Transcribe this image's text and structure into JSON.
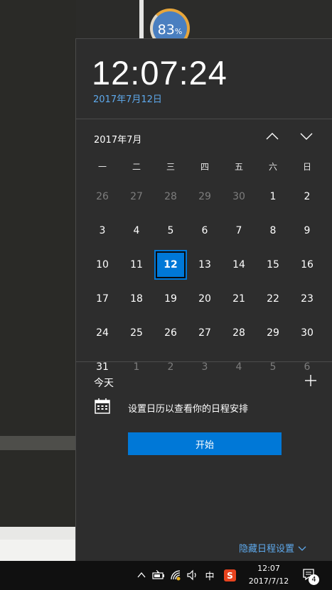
{
  "background": {
    "widget": {
      "value": "83",
      "unit": "%"
    }
  },
  "flyout": {
    "time": "12:07:24",
    "date": "2017年7月12日",
    "month_label": "2017年7月",
    "weekdays": [
      "一",
      "二",
      "三",
      "四",
      "五",
      "六",
      "日"
    ],
    "weeks": [
      [
        {
          "d": "26",
          "dim": true
        },
        {
          "d": "27",
          "dim": true
        },
        {
          "d": "28",
          "dim": true
        },
        {
          "d": "29",
          "dim": true
        },
        {
          "d": "30",
          "dim": true
        },
        {
          "d": "1"
        },
        {
          "d": "2"
        }
      ],
      [
        {
          "d": "3"
        },
        {
          "d": "4"
        },
        {
          "d": "5"
        },
        {
          "d": "6"
        },
        {
          "d": "7"
        },
        {
          "d": "8"
        },
        {
          "d": "9"
        }
      ],
      [
        {
          "d": "10"
        },
        {
          "d": "11"
        },
        {
          "d": "12",
          "today": true
        },
        {
          "d": "13"
        },
        {
          "d": "14"
        },
        {
          "d": "15"
        },
        {
          "d": "16"
        }
      ],
      [
        {
          "d": "17"
        },
        {
          "d": "18"
        },
        {
          "d": "19"
        },
        {
          "d": "20"
        },
        {
          "d": "21"
        },
        {
          "d": "22"
        },
        {
          "d": "23"
        }
      ],
      [
        {
          "d": "24"
        },
        {
          "d": "25"
        },
        {
          "d": "26"
        },
        {
          "d": "27"
        },
        {
          "d": "28"
        },
        {
          "d": "29"
        },
        {
          "d": "30"
        }
      ],
      [
        {
          "d": "31"
        },
        {
          "d": "1",
          "dim": true
        },
        {
          "d": "2",
          "dim": true
        },
        {
          "d": "3",
          "dim": true
        },
        {
          "d": "4",
          "dim": true
        },
        {
          "d": "5",
          "dim": true
        },
        {
          "d": "6",
          "dim": true
        }
      ]
    ],
    "today_label": "今天",
    "agenda_text": "设置日历以查看你的日程安排",
    "start_button": "开始",
    "hide_agenda_link": "隐藏日程设置"
  },
  "taskbar": {
    "ime": "中",
    "sogou": "S",
    "time": "12:07",
    "date": "2017/7/12",
    "notification_count": "4"
  },
  "colors": {
    "accent": "#0078d7",
    "link": "#5ea9ec",
    "flyout_bg": "#2d2d2d",
    "taskbar_bg": "#101010"
  }
}
